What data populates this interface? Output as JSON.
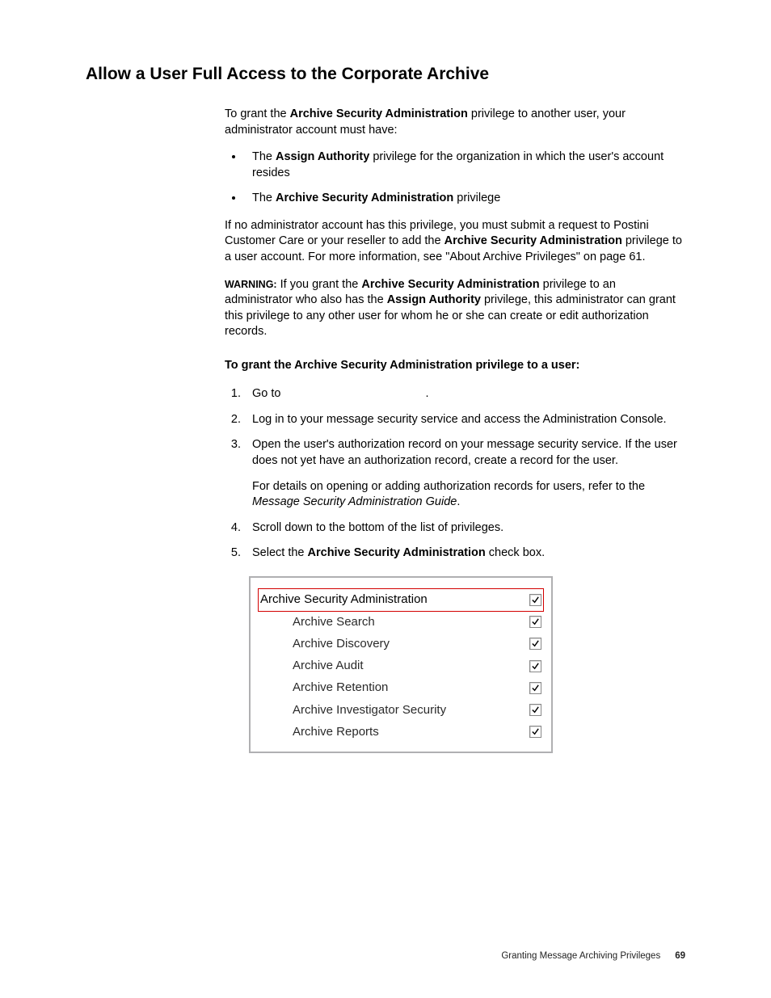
{
  "heading": "Allow a User Full Access to the Corporate Archive",
  "intro": {
    "lead": "To grant the ",
    "priv": "Archive Security Administration",
    "tail": " privilege to another user, your administrator account must have:"
  },
  "bullets": [
    {
      "lead": "The ",
      "bold": "Assign Authority",
      "tail": " privilege for the organization in which the user's account resides"
    },
    {
      "lead": "The ",
      "bold": "Archive Security Administration",
      "tail": " privilege"
    }
  ],
  "noadmin": {
    "a": "If no administrator account has this privilege, you must submit a request to Postini Customer Care or your reseller to add the ",
    "b": "Archive Security Administration",
    "c": " privilege to a user account. For more information, see \"About Archive Privileges\" on page 61."
  },
  "warning": {
    "label": "WARNING:",
    "a": " If you grant the ",
    "b": "Archive Security Administration",
    "c": " privilege to an administrator who also has the ",
    "d": "Assign Authority",
    "e": " privilege, this administrator can grant this privilege to any other user for whom he or she can create or edit authorization records."
  },
  "steps_heading": "To grant the Archive Security Administration privilege to a user:",
  "steps": {
    "s1a": "Go to ",
    "s1b": ".",
    "s2": "Log in to your message security service and access the Administration Console.",
    "s3a": "Open the user's authorization record on your message security service. If the user does not yet have an authorization record, create a record for the user.",
    "s3b": "For details on opening or adding authorization records for users, refer to the ",
    "s3c": "Message Security Administration Guide",
    "s3d": ".",
    "s4": "Scroll down to the bottom of the list of privileges.",
    "s5a": "Select the ",
    "s5b": "Archive Security Administration",
    "s5c": " check box."
  },
  "priv_table": {
    "header": "Archive Security Administration",
    "rows": [
      "Archive Search",
      "Archive Discovery",
      "Archive Audit",
      "Archive Retention",
      "Archive Investigator Security",
      "Archive Reports"
    ]
  },
  "footer": {
    "text": "Granting Message Archiving Privileges",
    "page": "69"
  }
}
